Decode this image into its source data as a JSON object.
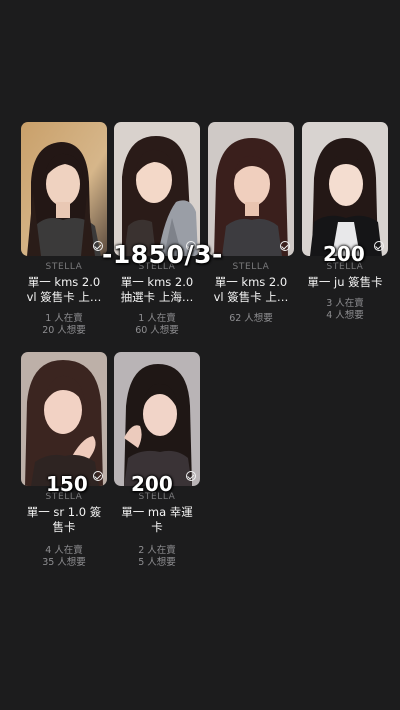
{
  "cards": [
    {
      "group": "STELLA",
      "title": "單一 kms 2.0\nvl 簽售卡 上…",
      "stat1": "1 人在賣",
      "stat2": "20 人想要",
      "selected_icon": "check-circle-icon"
    },
    {
      "group": "STELLA",
      "title": "單一 kms 2.0\n抽選卡 上海…",
      "stat1": "1 人在賣",
      "stat2": "60 人想要",
      "selected_icon": "check-circle-icon"
    },
    {
      "group": "STELLA",
      "title": "單一 kms 2.0\nvl 簽售卡 上…",
      "stat1": "",
      "stat2": "62 人想要",
      "selected_icon": "check-circle-icon"
    },
    {
      "group": "STELLA",
      "title": "單一 ju 簽售卡",
      "stat1": "3 人在賣",
      "stat2": "4 人想要",
      "selected_icon": "check-circle-icon"
    },
    {
      "group": "STELLA",
      "title": "單一 sr 1.0 簽\n售卡",
      "stat1": "4 人在賣",
      "stat2": "35 人想要",
      "selected_icon": "check-circle-icon"
    },
    {
      "group": "STELLA",
      "title": "單一 ma 幸運\n卡",
      "stat1": "2 人在賣",
      "stat2": "5 人想要",
      "selected_icon": "check-circle-icon"
    }
  ],
  "overlays": {
    "range_price": "-1850/3-",
    "price_card4": "200",
    "price_card5": "150",
    "price_card6": "200"
  },
  "colors": {
    "background": "#1c1c1d",
    "text_primary": "#f4f4f4",
    "text_secondary": "#8e8e91"
  }
}
